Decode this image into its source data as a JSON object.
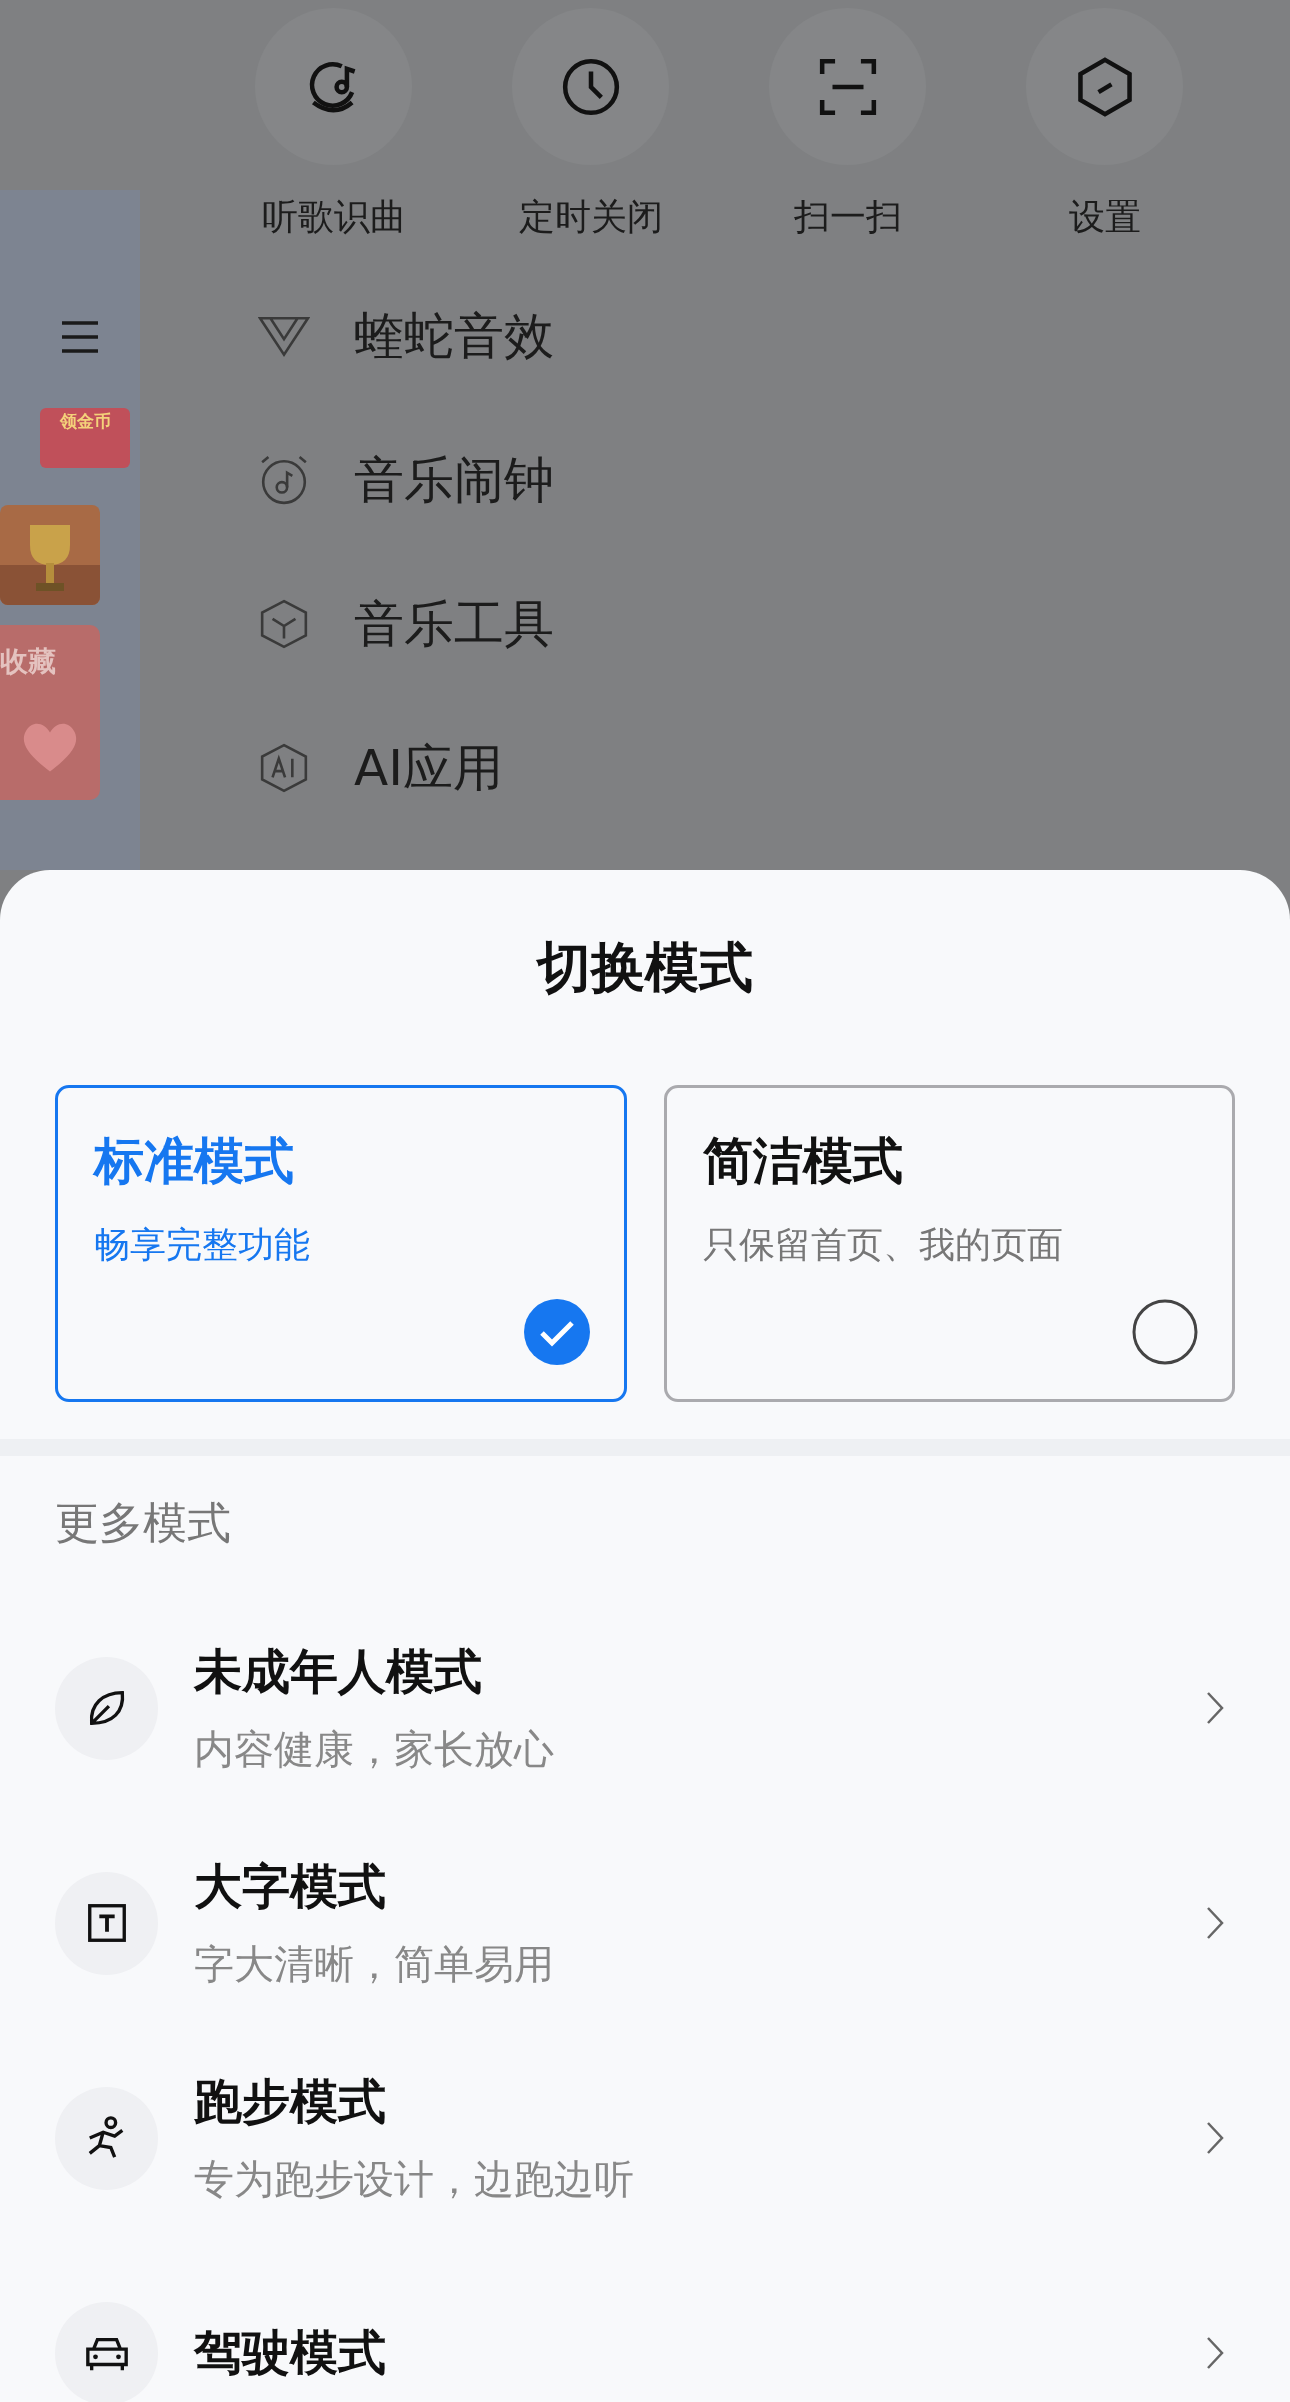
{
  "background_app": {
    "badge": "领金币",
    "card_text": "收藏"
  },
  "drawer": {
    "quick_actions": [
      {
        "label": "听歌识曲",
        "kind": "recognize"
      },
      {
        "label": "定时关闭",
        "kind": "timer"
      },
      {
        "label": "扫一扫",
        "kind": "scan"
      },
      {
        "label": "设置",
        "kind": "settings"
      }
    ],
    "menu": [
      {
        "label": "蝰蛇音效",
        "kind": "viper"
      },
      {
        "label": "音乐闹钟",
        "kind": "alarm"
      },
      {
        "label": "音乐工具",
        "kind": "tools"
      },
      {
        "label": "AI应用",
        "kind": "ai"
      }
    ]
  },
  "sheet": {
    "title": "切换模式",
    "modes": [
      {
        "title": "标准模式",
        "subtitle": "畅享完整功能",
        "selected": true
      },
      {
        "title": "简洁模式",
        "subtitle": "只保留首页、我的页面",
        "selected": false
      }
    ],
    "more_heading": "更多模式",
    "more_modes": [
      {
        "title": "未成年人模式",
        "subtitle": "内容健康，家长放心",
        "kind": "teen"
      },
      {
        "title": "大字模式",
        "subtitle": "字大清晰，简单易用",
        "kind": "bigtext"
      },
      {
        "title": "跑步模式",
        "subtitle": "专为跑步设计，边跑边听",
        "kind": "run"
      },
      {
        "title": "驾驶模式",
        "kind": "car"
      }
    ]
  }
}
